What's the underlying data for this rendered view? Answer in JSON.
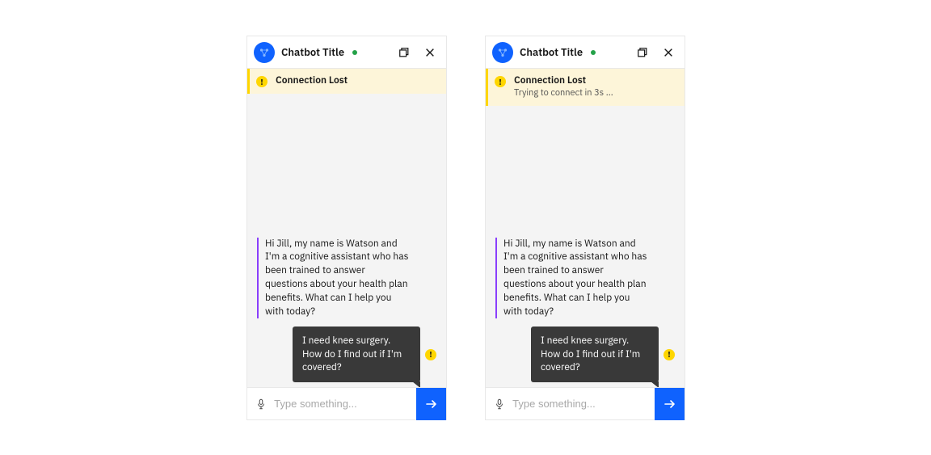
{
  "panels": [
    {
      "header": {
        "title": "Chatbot Title"
      },
      "banner": {
        "title": "Connection Lost",
        "subtitle": ""
      },
      "bot_message": "Hi Jill, my name is Watson and I'm a cognitive assistant who has been trained to answer questions about your health plan benefits. What can I help you with today?",
      "user_message": "I need knee surgery. How do I find out if I'm covered?",
      "input": {
        "placeholder": "Type something..."
      }
    },
    {
      "header": {
        "title": "Chatbot Title"
      },
      "banner": {
        "title": "Connection Lost",
        "subtitle": "Trying to connect in 3s ..."
      },
      "bot_message": "Hi Jill, my name is Watson and I'm a cognitive assistant who has been trained to answer questions about your health plan benefits. What can I help you with today?",
      "user_message": "I need knee surgery. How do I find out if I'm covered?",
      "input": {
        "placeholder": "Type something..."
      }
    }
  ],
  "colors": {
    "primary": "#0f62fe",
    "purple": "#8a3ffc",
    "warning": "#ffd600",
    "success": "#24a148",
    "dark": "#393939"
  }
}
